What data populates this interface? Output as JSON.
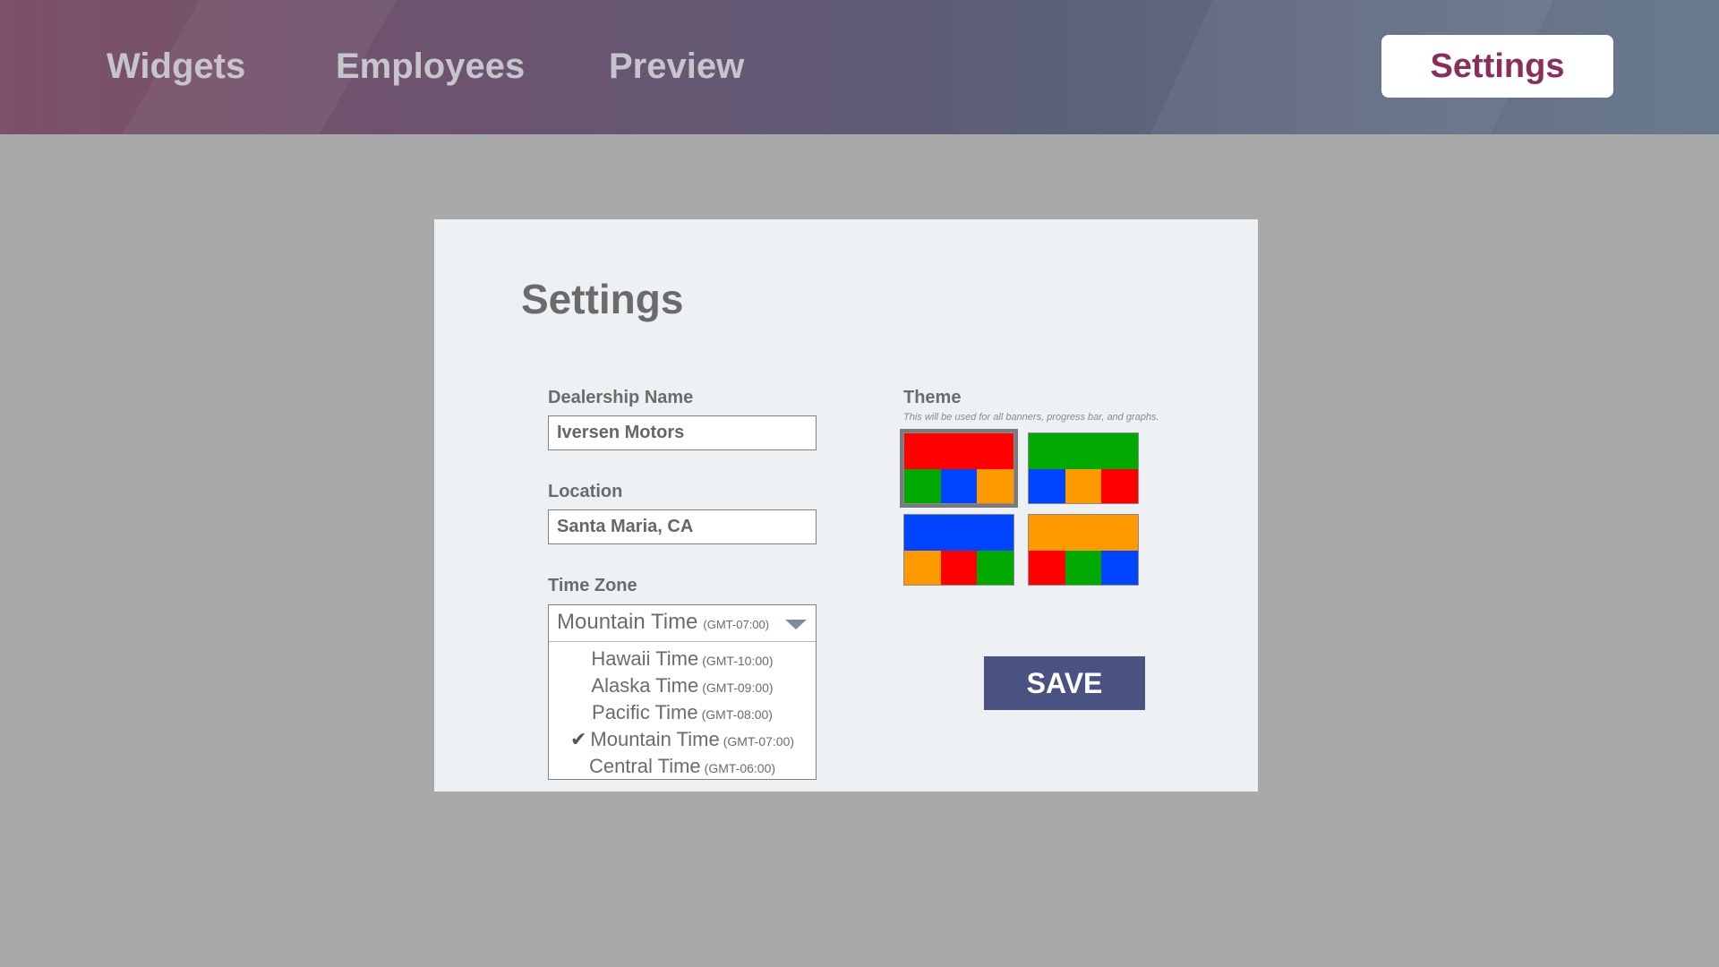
{
  "nav": {
    "items": [
      {
        "label": "Widgets"
      },
      {
        "label": "Employees"
      },
      {
        "label": "Preview"
      }
    ],
    "active": "Settings"
  },
  "page": {
    "title": "Settings"
  },
  "form": {
    "dealership": {
      "label": "Dealership Name",
      "value": "Iversen Motors"
    },
    "location": {
      "label": "Location",
      "value": "Santa Maria, CA"
    },
    "timezone": {
      "label": "Time Zone",
      "selected": {
        "name": "Mountain Time",
        "offset": "(GMT-07:00)"
      },
      "options": [
        {
          "name": "Hawaii Time",
          "offset": "(GMT-10:00)",
          "checked": false
        },
        {
          "name": "Alaska Time",
          "offset": "(GMT-09:00)",
          "checked": false
        },
        {
          "name": "Pacific Time",
          "offset": "(GMT-08:00)",
          "checked": false
        },
        {
          "name": "Mountain Time",
          "offset": "(GMT-07:00)",
          "checked": true
        },
        {
          "name": "Central Time",
          "offset": "(GMT-06:00)",
          "checked": false
        }
      ],
      "check_glyph": "✔"
    }
  },
  "theme": {
    "label": "Theme",
    "hint": "This will be used for all banners, progress bar, and graphs.",
    "selected_index": 0,
    "swatches": [
      {
        "primary": "#ff0000",
        "secondary": [
          "#00aa00",
          "#0044ff",
          "#ff9900"
        ]
      },
      {
        "primary": "#00aa00",
        "secondary": [
          "#0044ff",
          "#ff9900",
          "#ff0000"
        ]
      },
      {
        "primary": "#0044ff",
        "secondary": [
          "#ff9900",
          "#ff0000",
          "#00aa00"
        ]
      },
      {
        "primary": "#ff9900",
        "secondary": [
          "#ff0000",
          "#00aa00",
          "#0044ff"
        ]
      }
    ]
  },
  "actions": {
    "save_label": "SAVE"
  },
  "colors": {
    "accent": "#8a2f5a",
    "button": "#4a5282"
  }
}
